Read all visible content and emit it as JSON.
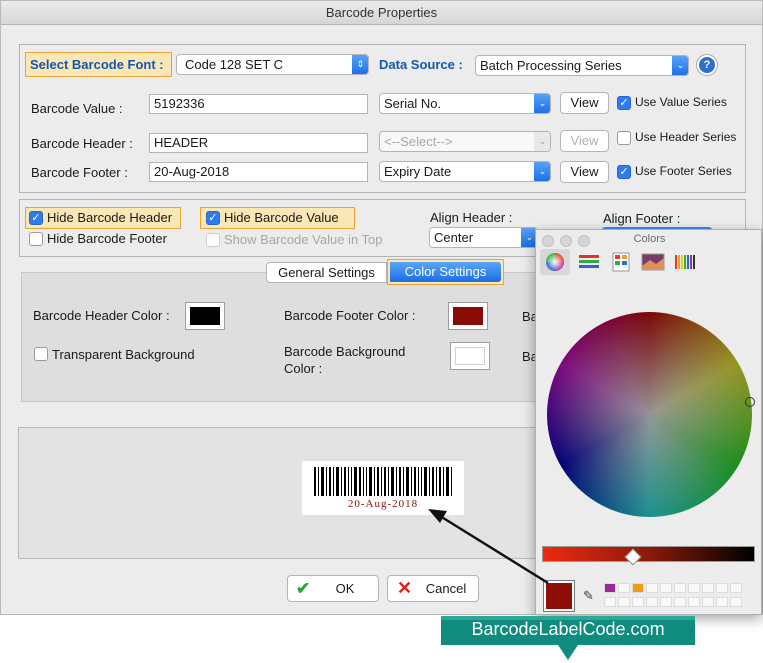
{
  "window": {
    "title": "Barcode Properties"
  },
  "top_section": {
    "select_font_label": "Select Barcode Font :",
    "font_value": "Code 128 SET C",
    "data_source_label": "Data Source :",
    "data_source_value": "Batch Processing Series",
    "help_label": "?",
    "rows": [
      {
        "label": "Barcode Value :",
        "value": "5192336",
        "series": "Serial No.",
        "view": "View",
        "checkbox": "Use Value Series",
        "checked": true,
        "disabled": false
      },
      {
        "label": "Barcode Header :",
        "value": "HEADER",
        "series": "<--Select-->",
        "view": "View",
        "checkbox": "Use Header Series",
        "checked": false,
        "disabled": true
      },
      {
        "label": "Barcode Footer :",
        "value": "20-Aug-2018",
        "series": "Expiry Date",
        "view": "View",
        "checkbox": "Use Footer Series",
        "checked": true,
        "disabled": false
      }
    ]
  },
  "options": {
    "hide_header": "Hide Barcode Header",
    "hide_value": "Hide Barcode Value",
    "hide_footer": "Hide Barcode Footer",
    "show_value_top": "Show Barcode Value in Top",
    "align_header_label": "Align Header :",
    "align_header_value": "Center",
    "align_footer_label": "Align Footer :"
  },
  "tabs": {
    "general": "General Settings",
    "color": "Color Settings"
  },
  "color_settings": {
    "header_color_label": "Barcode Header Color :",
    "header_color": "#000000",
    "footer_color_label": "Barcode Footer Color :",
    "footer_color": "#8a0c06",
    "transparent_label": "Transparent Background",
    "background_label_1": "Barcode Background",
    "background_label_2": "Color :",
    "background_color": "#ffffff",
    "clipped_1": "Ba",
    "clipped_2": "Ba"
  },
  "preview": {
    "footer_text": "20-Aug-2018",
    "footer_color": "#8a0c06"
  },
  "buttons": {
    "ok": "OK",
    "cancel": "Cancel"
  },
  "colors_panel": {
    "title": "Colors",
    "selected_color": "#8f0f08",
    "palette": [
      "#9b2a96",
      "#f09a12"
    ]
  },
  "banner": {
    "text": "BarcodeLabelCode.com"
  }
}
